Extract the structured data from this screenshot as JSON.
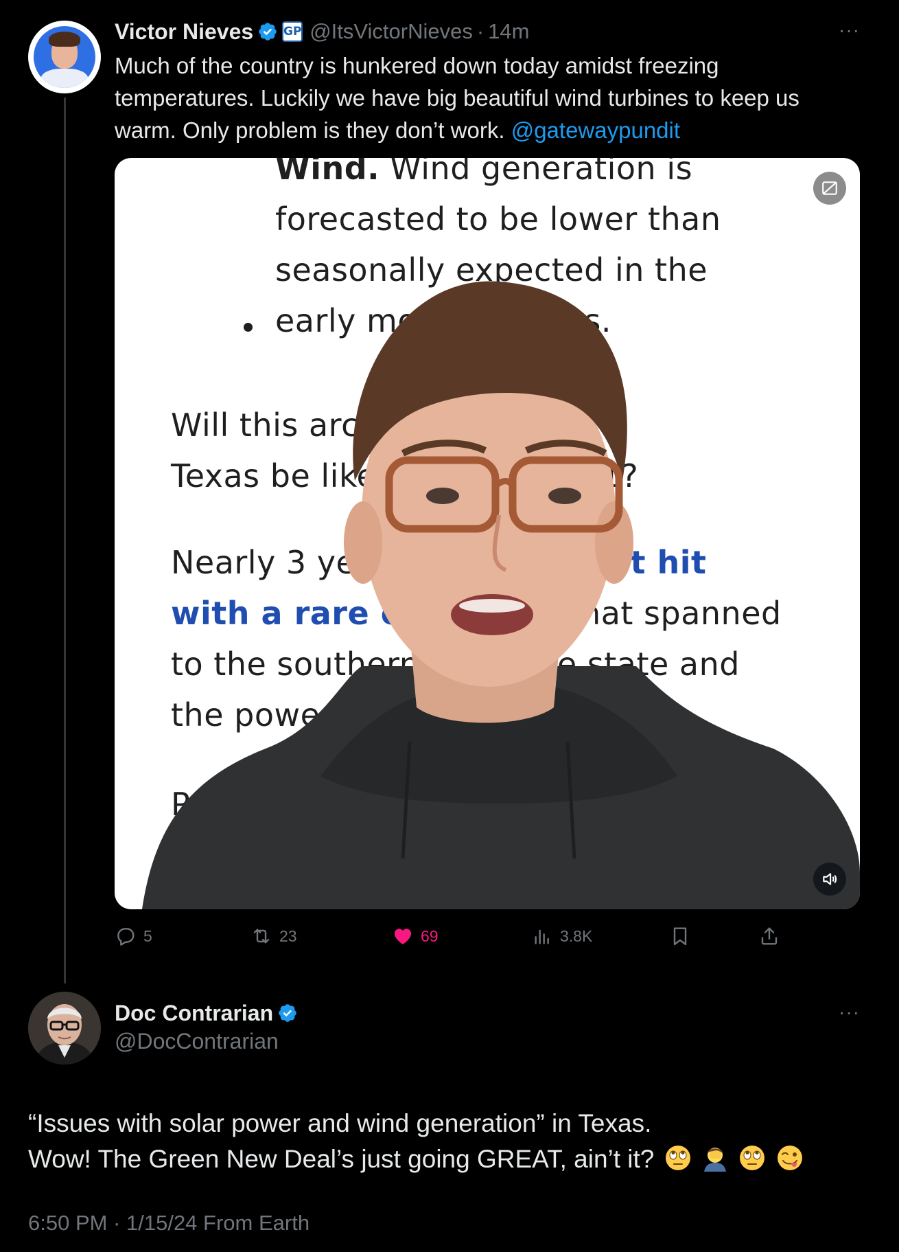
{
  "tweet1": {
    "author_name": "Victor Nieves",
    "affiliate_badge": "GP",
    "handle": "@ItsVictorNieves",
    "separator": "·",
    "time": "14m",
    "text_before_mention": "Much of the country is hunkered down today amidst freezing temperatures. Luckily we have big beautiful wind turbines to keep us warm. Only problem is they don’t work.",
    "mention": "@gatewaypundit",
    "media_text": {
      "bullet_line1_bold": "Wind.",
      "bullet_line1_rest": " Wind generation is",
      "bullet_line2": "forecasted to be lower than",
      "bullet_line3": "seasonally expected in the",
      "bullet_line4": "early morning hours.",
      "para1_line1": "Will this arctic blast in",
      "para1_line2": "Texas be like February 2021?",
      "para2_line1_start": "Nearly 3 years ago Texas ",
      "para2_line1_link": "got hit",
      "para2_line2_link": "with a rare cold blast",
      "para2_line2_rest": " that spanned",
      "para2_line3": "to the southern tip of the state and",
      "para2_line4": "the power grid failed.",
      "para3_line1": "Po"
    },
    "stats": {
      "replies": "5",
      "reposts": "23",
      "likes": "69",
      "views": "3.8K"
    },
    "colors": {
      "like": "#f91880",
      "mention": "#1d9bf0",
      "verified": "#1d9bf0"
    }
  },
  "tweet2": {
    "author_name": "Doc Contrarian",
    "handle": "@DocContrarian",
    "text_line1": "“Issues with solar power and wind generation” in Texas.",
    "text_line2": "Wow! The Green New Deal’s just going GREAT, ain’t it?",
    "emojis": [
      "face-with-rolling-eyes",
      "man-facepalming",
      "face-with-rolling-eyes",
      "winking-face-with-tongue"
    ],
    "meta": "6:50 PM · 1/15/24 From Earth"
  }
}
